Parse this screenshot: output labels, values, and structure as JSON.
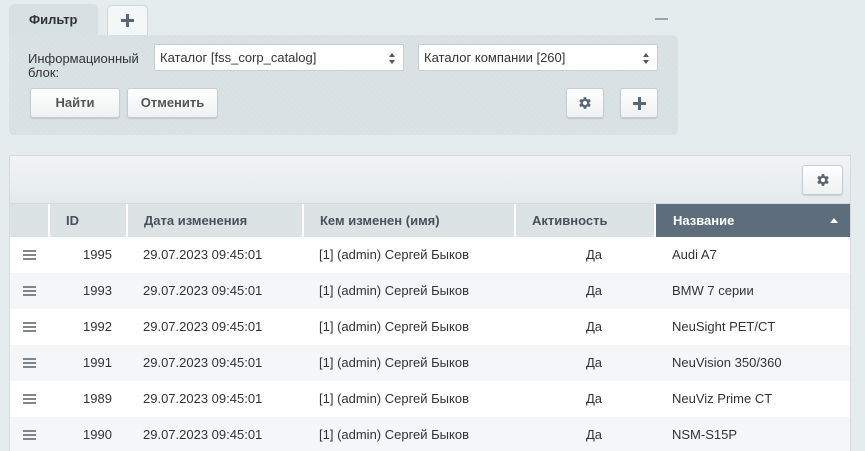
{
  "filter": {
    "tab_label": "Фильтр",
    "iblock_label": "Информационный блок:",
    "iblock_type_value": "Каталог [fss_corp_catalog]",
    "iblock_value": "Каталог компании [260]",
    "find_label": "Найти",
    "cancel_label": "Отменить"
  },
  "grid": {
    "columns": {
      "id": "ID",
      "date": "Дата изменения",
      "modified_by": "Кем изменен (имя)",
      "active": "Активность",
      "name": "Название"
    },
    "sorted_column": "name",
    "sort_direction": "asc",
    "rows": [
      {
        "id": "1995",
        "date": "29.07.2023 09:45:01",
        "modified_by": "[1] (admin) Сергей Быков",
        "active": "Да",
        "name": "Audi A7"
      },
      {
        "id": "1993",
        "date": "29.07.2023 09:45:01",
        "modified_by": "[1] (admin) Сергей Быков",
        "active": "Да",
        "name": "BMW 7 серии"
      },
      {
        "id": "1992",
        "date": "29.07.2023 09:45:01",
        "modified_by": "[1] (admin) Сергей Быков",
        "active": "Да",
        "name": "NeuSight PET/CT"
      },
      {
        "id": "1991",
        "date": "29.07.2023 09:45:01",
        "modified_by": "[1] (admin) Сергей Быков",
        "active": "Да",
        "name": "NeuVision 350/360"
      },
      {
        "id": "1989",
        "date": "29.07.2023 09:45:01",
        "modified_by": "[1] (admin) Сергей Быков",
        "active": "Да",
        "name": "NeuViz Prime CT"
      },
      {
        "id": "1990",
        "date": "29.07.2023 09:45:01",
        "modified_by": "[1] (admin) Сергей Быков",
        "active": "Да",
        "name": "NSM-S15P"
      }
    ]
  },
  "colors": {
    "page_background": "#e5ecee",
    "panel_background": "#d7e0e2",
    "sorted_header": "#5e6d7c",
    "alt_row": "#f4f6f7"
  },
  "icons": {
    "add_tab": "plus-icon",
    "minimize": "minus-icon",
    "filter_settings": "gear-icon",
    "add_field": "plus-icon",
    "grid_settings": "gear-icon",
    "row_action": "hamburger-icon",
    "sort": "triangle-up-icon"
  }
}
